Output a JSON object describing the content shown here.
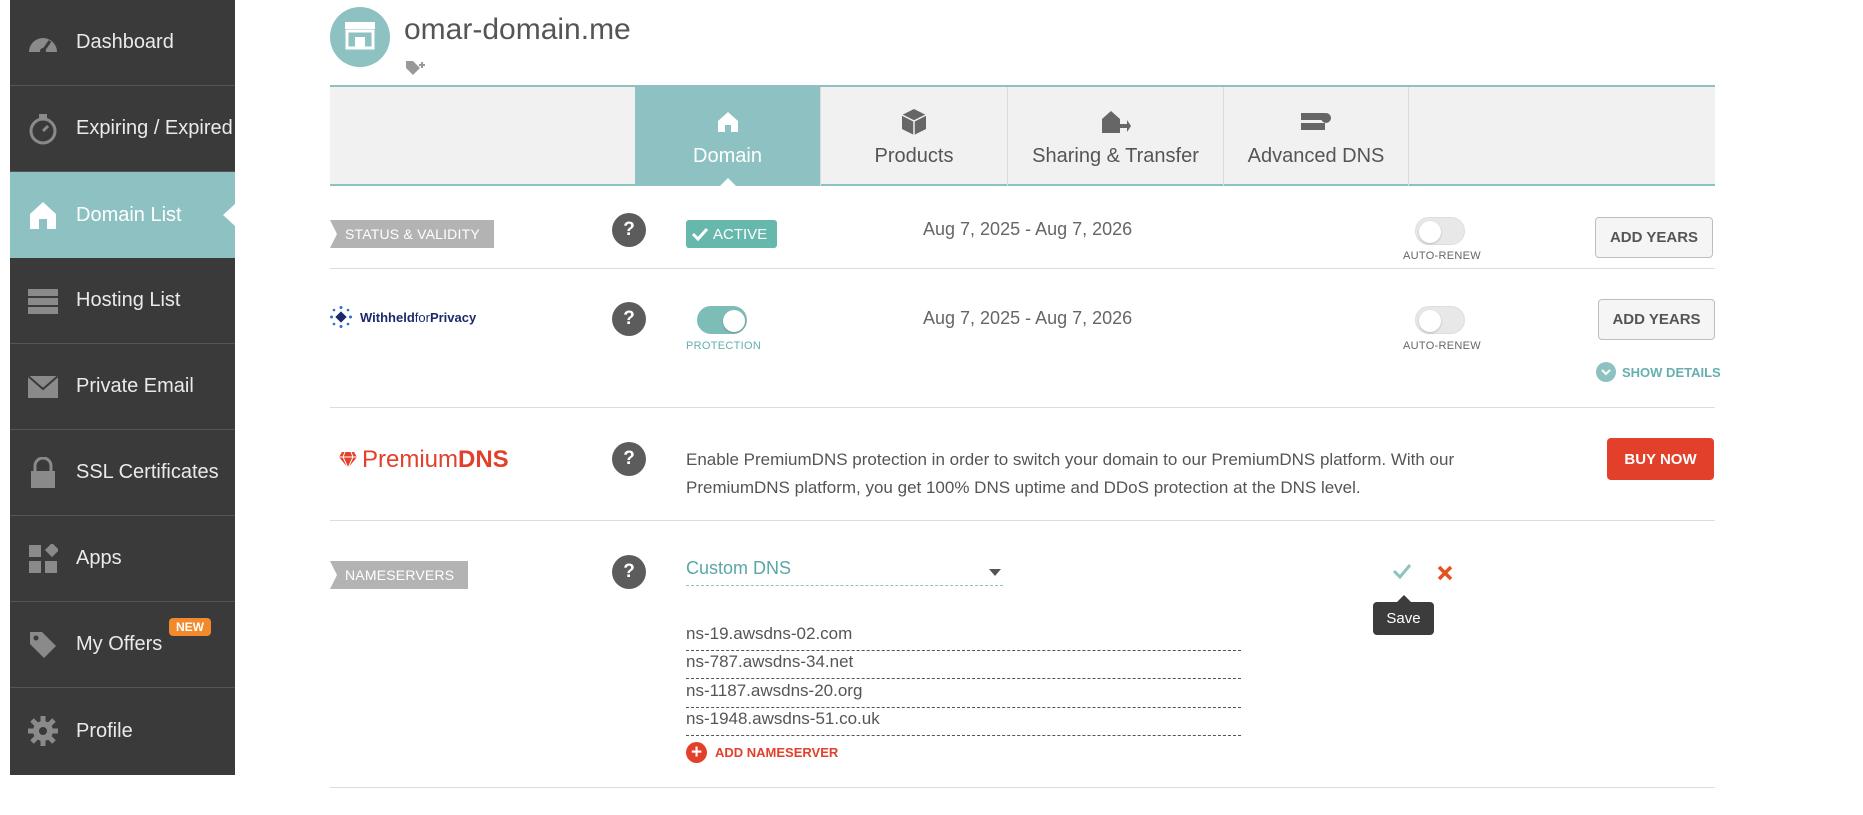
{
  "sidebar": {
    "items": [
      {
        "label": "Dashboard",
        "icon": "speedometer-icon"
      },
      {
        "label": "Expiring / Expired",
        "icon": "stopwatch-icon"
      },
      {
        "label": "Domain List",
        "icon": "house-icon",
        "active": true
      },
      {
        "label": "Hosting List",
        "icon": "server-icon"
      },
      {
        "label": "Private Email",
        "icon": "envelope-icon"
      },
      {
        "label": "SSL Certificates",
        "icon": "lock-icon"
      },
      {
        "label": "Apps",
        "icon": "apps-icon"
      },
      {
        "label": "My Offers",
        "icon": "tag-icon",
        "badge": "NEW"
      },
      {
        "label": "Profile",
        "icon": "gear-icon"
      }
    ]
  },
  "header": {
    "domain": "omar-domain.me",
    "avatar_icon": "storefront-icon",
    "tag_icon": "tag-add-icon"
  },
  "tabs": [
    {
      "label": "Domain",
      "icon": "house-icon",
      "active": true
    },
    {
      "label": "Products",
      "icon": "box-icon"
    },
    {
      "label": "Sharing & Transfer",
      "icon": "house-transfer-icon"
    },
    {
      "label": "Advanced DNS",
      "icon": "dns-server-icon"
    }
  ],
  "status": {
    "section_label": "STATUS & VALIDITY",
    "help": "?",
    "badge": "ACTIVE",
    "date_range": "Aug 7, 2025 - Aug 7, 2026",
    "autorenew_label": "AUTO-RENEW",
    "autorenew_on": false,
    "add_years": "ADD YEARS"
  },
  "privacy": {
    "logo_text_a": "Withheld",
    "logo_text_b": "for",
    "logo_text_c": "Privacy",
    "help": "?",
    "protection_label": "PROTECTION",
    "protection_on": true,
    "date_range": "Aug 7, 2025 - Aug 7, 2026",
    "autorenew_label": "AUTO-RENEW",
    "autorenew_on": false,
    "add_years": "ADD YEARS",
    "show_details": "SHOW DETAILS"
  },
  "premium_dns": {
    "logo_a": "Premium",
    "logo_b": "DNS",
    "help": "?",
    "description": "Enable PremiumDNS protection in order to switch your domain to our PremiumDNS platform. With our PremiumDNS platform, you get 100% DNS uptime and DDoS protection at the DNS level.",
    "buy_now": "BUY NOW"
  },
  "nameservers": {
    "section_label": "NAMESERVERS",
    "help": "?",
    "selected": "Custom DNS",
    "save_tooltip": "Save",
    "servers": [
      "ns-19.awsdns-02.com",
      "ns-787.awsdns-34.net",
      "ns-1187.awsdns-20.org",
      "ns-1948.awsdns-51.co.uk"
    ],
    "add_label": "ADD NAMESERVER"
  },
  "colors": {
    "teal": "#8ec1c1",
    "sidebar_bg": "#3a3a3a",
    "red": "#e2402a",
    "badge_orange": "#f08a2c"
  }
}
